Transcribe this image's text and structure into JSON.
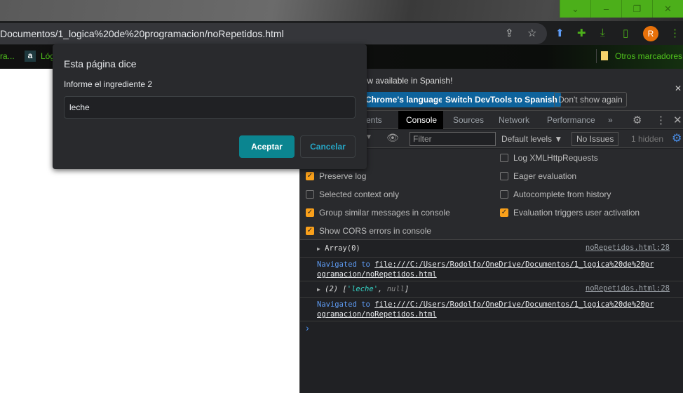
{
  "browser": {
    "url": "Documentos/1_logica%20de%20programacion/noRepetidos.html",
    "avatar_initial": "R",
    "bookmarks": [
      {
        "label": "ra..."
      },
      {
        "label": "Lóg"
      }
    ],
    "other_bookmarks": "Otros marcadores",
    "accent": "#4caf1a"
  },
  "dialog": {
    "title": "Esta página dice",
    "message": "Informe el ingrediente 2",
    "input_value": "leche",
    "ok_label": "Aceptar",
    "cancel_label": "Cancelar"
  },
  "devtools": {
    "infobar": {
      "text": "now available in Spanish!",
      "btn_language": "Chrome's language",
      "btn_switch": "Switch DevTools to Spanish",
      "btn_dont": "Don't show again"
    },
    "tabs": [
      {
        "label": "ments"
      },
      {
        "label": "Console"
      },
      {
        "label": "Sources"
      },
      {
        "label": "Network"
      },
      {
        "label": "Performance"
      }
    ],
    "more_tabs": "»",
    "toolbar": {
      "filter_placeholder": "Filter",
      "levels": "Default levels ▼",
      "issues": "No Issues",
      "hidden": "1 hidden"
    },
    "settings": [
      {
        "label": "Preserve log",
        "checked": true
      },
      {
        "label": "Selected context only",
        "checked": false
      },
      {
        "label": "Group similar messages in console",
        "checked": true
      },
      {
        "label": "Show CORS errors in console",
        "checked": true
      },
      {
        "label": "Log XMLHttpRequests",
        "checked": false
      },
      {
        "label": "Eager evaluation",
        "checked": false
      },
      {
        "label": "Autocomplete from history",
        "checked": false
      },
      {
        "label": "Evaluation triggers user activation",
        "checked": true
      }
    ],
    "messages": {
      "m1": {
        "text": "Array(0)",
        "source": "noRepetidos.html:28"
      },
      "m2": {
        "prefix": "Navigated to",
        "link1": "file:///C:/Users/Rodolfo/OneDrive/Documentos/1_logica%20de%20pr",
        "link2": "ogramacion/noRepetidos.html"
      },
      "m3": {
        "count": "(2) [",
        "str": "'leche'",
        "sep": ", ",
        "nul": "null",
        "end": "]",
        "source": "noRepetidos.html:28"
      },
      "m4": {
        "prefix": "Navigated to",
        "link1": "file:///C:/Users/Rodolfo/OneDrive/Documentos/1_logica%20de%20pr",
        "link2": "ogramacion/noRepetidos.html"
      }
    },
    "prompt": "›"
  }
}
